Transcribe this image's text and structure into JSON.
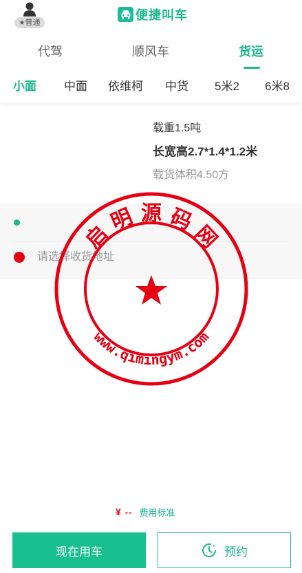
{
  "header": {
    "member_badge": "普通",
    "app_title": "便捷叫车",
    "icons": {
      "avatar": "user-avatar-icon",
      "badge": "star-icon",
      "title": "car-icon"
    }
  },
  "service_tabs": [
    {
      "label": "代驾",
      "active": false
    },
    {
      "label": "顺风车",
      "active": false
    },
    {
      "label": "货运",
      "active": true
    }
  ],
  "vehicle_tabs": [
    {
      "label": "小面",
      "active": true
    },
    {
      "label": "中面",
      "active": false
    },
    {
      "label": "依维柯",
      "active": false
    },
    {
      "label": "中货",
      "active": false
    },
    {
      "label": "5米2",
      "active": false
    },
    {
      "label": "6米8",
      "active": false
    }
  ],
  "vehicle_spec": {
    "load": "载重1.5吨",
    "dimensions": "长宽高2.7*1.4*1.2米",
    "volume": "载货体积4.50方"
  },
  "address": {
    "pickup_value": "",
    "dropoff_placeholder": "请选择收货地址"
  },
  "watermark": {
    "text_top": "启 明 源 码 网",
    "text_bottom": "www.qimingym.com"
  },
  "fee": {
    "currency": "¥",
    "amount": "--",
    "link_label": "费用标准"
  },
  "actions": {
    "now_label": "现在用车",
    "reserve_label": "预约"
  },
  "colors": {
    "accent": "#19b98e",
    "button_fill": "#19c08f",
    "alert_red": "#e60012",
    "panel_bg": "#f7f7f7"
  }
}
